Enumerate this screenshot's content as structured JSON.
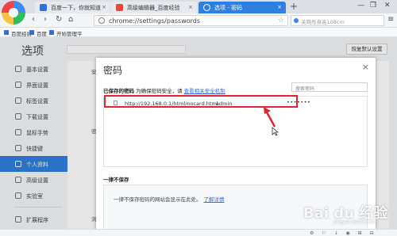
{
  "tabs": [
    {
      "label": "百度一下，你就知道",
      "close": "×"
    },
    {
      "label": "高级编辑器_百度经验",
      "close": "×"
    },
    {
      "label": "选项 - 密码",
      "close": "×"
    }
  ],
  "tabbar": {
    "new_tab": "+",
    "minimize": "—",
    "restore": "❐",
    "close": "✕"
  },
  "nav": {
    "back": "‹",
    "forward": "›",
    "refresh": "↻",
    "home": "⌂",
    "menu": "≡"
  },
  "address": {
    "url": "chrome://settings/passwords",
    "bookmark_star": "☆"
  },
  "search": {
    "placeholder": "关晓彤身高108cm"
  },
  "bookmarks": [
    "百度经验",
    "百度",
    "开始管理平"
  ],
  "settings": {
    "title": "选项",
    "restore_button": "恢复默认设置",
    "sidebar": [
      {
        "label": "基本设置",
        "active": false
      },
      {
        "label": "界面设置",
        "active": false
      },
      {
        "label": "标签设置",
        "active": false
      },
      {
        "label": "下载设置",
        "active": false
      },
      {
        "label": "鼠标手势",
        "active": false
      },
      {
        "label": "快捷键",
        "active": false
      },
      {
        "label": "个人资料",
        "active": true
      },
      {
        "label": "高级设置",
        "active": false
      },
      {
        "label": "实验室",
        "active": false
      },
      {
        "label": "扩展程序",
        "active": false
      }
    ],
    "side_chars": [
      "安",
      "密",
      "浏"
    ]
  },
  "dialog": {
    "title": "密码",
    "close": "×",
    "saved_heading": "已保存的密码",
    "saved_note": "为确保密码安全，请",
    "saved_link": "查看相关安全机制",
    "search_placeholder": "搜索密码",
    "entries": [
      {
        "site": "http://192.168.0.1/html/nocard.html",
        "user": "admin",
        "password": "•••••••"
      }
    ],
    "never_heading": "一律不保存",
    "never_text": "一律不保存密码的网站会显示在此处。",
    "never_link": "了解详情"
  },
  "watermark": {
    "main": "Bai du 经验",
    "sub": "jingyan.baidu.com"
  },
  "statusbar": {
    "icons": "⚙ ⚐ ↓ ◉ ⊞ ⊟"
  },
  "colors": {
    "accent": "#2f7fe0",
    "highlight": "#e02530"
  }
}
